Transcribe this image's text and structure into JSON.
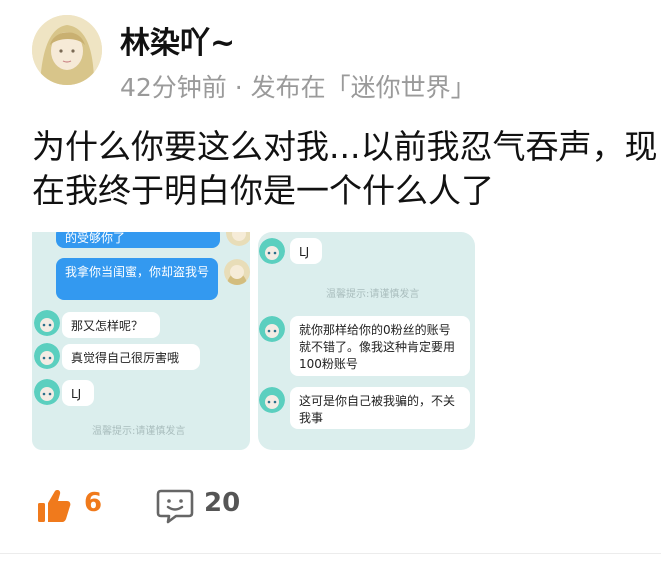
{
  "post": {
    "username": "林染吖~",
    "meta": "42分钟前 · 发布在「迷你世界」",
    "text_line1": "为什么你要这么对我...以前我忍气吞声，现",
    "text_line2": "在我终于明白你是一个什么人了"
  },
  "screenshot_left": {
    "msg_top": "的受够你了",
    "msg_blue": "我拿你当闺蜜，你却盗我号",
    "msg_1": "那又怎样呢？",
    "msg_2": "真觉得自己很厉害哦",
    "msg_3": "LJ",
    "tip": "温馨提示:请谨慎发言"
  },
  "screenshot_right": {
    "msg_1": "LJ",
    "tip": "温馨提示:请谨慎发言",
    "msg_2": "就你那样给你的0粉丝的账号就不错了。像我这种肯定要用100粉账号",
    "msg_3": "这可是你自己被我骗的，不关我事"
  },
  "actions": {
    "like_count": "6",
    "comment_count": "20"
  },
  "colors": {
    "accent_orange": "#f07a1c",
    "chat_bg": "#dbeeed",
    "bubble_blue": "#3399f0"
  }
}
